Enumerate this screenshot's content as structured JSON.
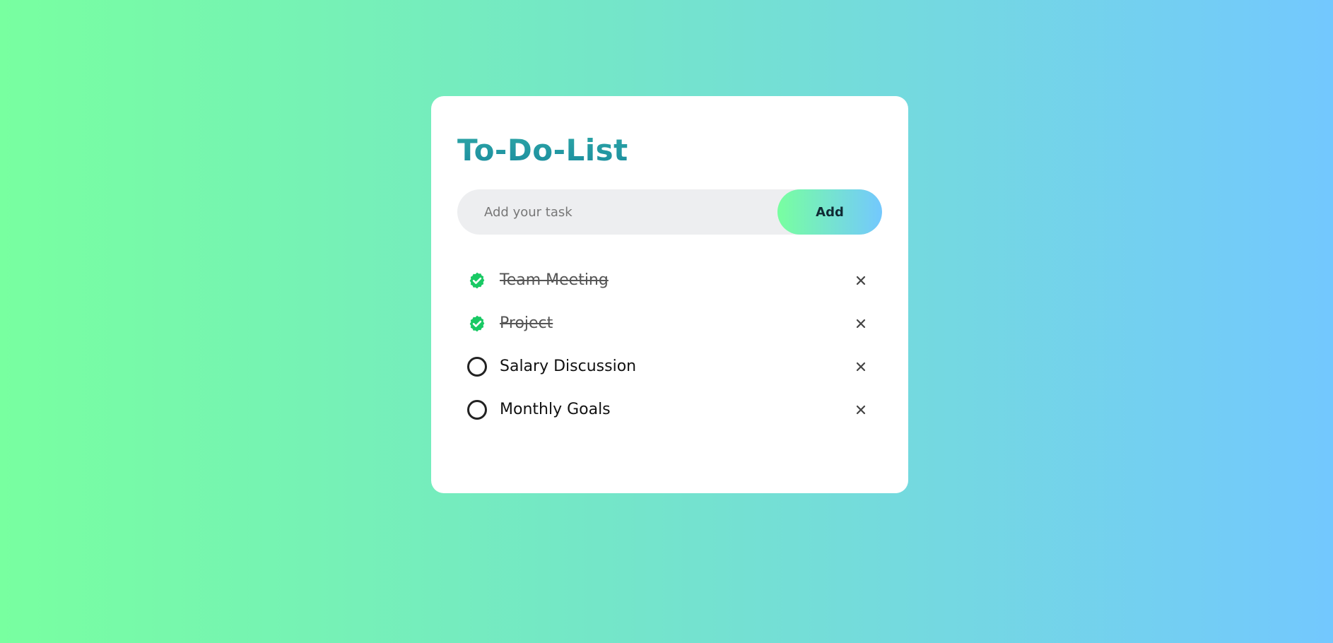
{
  "colors": {
    "background_start": "#78ffa0",
    "background_end": "#73c8fe",
    "title_gradient_start": "#3fc0ae",
    "title_gradient_end": "#1c8e9f",
    "checked": "#19c964",
    "unchecked_ring": "#222222"
  },
  "header": {
    "title": "To-Do-List"
  },
  "input": {
    "placeholder": "Add your task",
    "value": ""
  },
  "add_button": {
    "label": "Add"
  },
  "tasks": [
    {
      "text": "Team Meeting",
      "done": true,
      "status_icon": "checked-badge-icon",
      "remove_icon": "close-icon"
    },
    {
      "text": "Project",
      "done": true,
      "status_icon": "checked-badge-icon",
      "remove_icon": "close-icon"
    },
    {
      "text": "Salary Discussion",
      "done": false,
      "status_icon": "unchecked-circle-icon",
      "remove_icon": "close-icon"
    },
    {
      "text": "Monthly Goals",
      "done": false,
      "status_icon": "unchecked-circle-icon",
      "remove_icon": "close-icon"
    }
  ]
}
